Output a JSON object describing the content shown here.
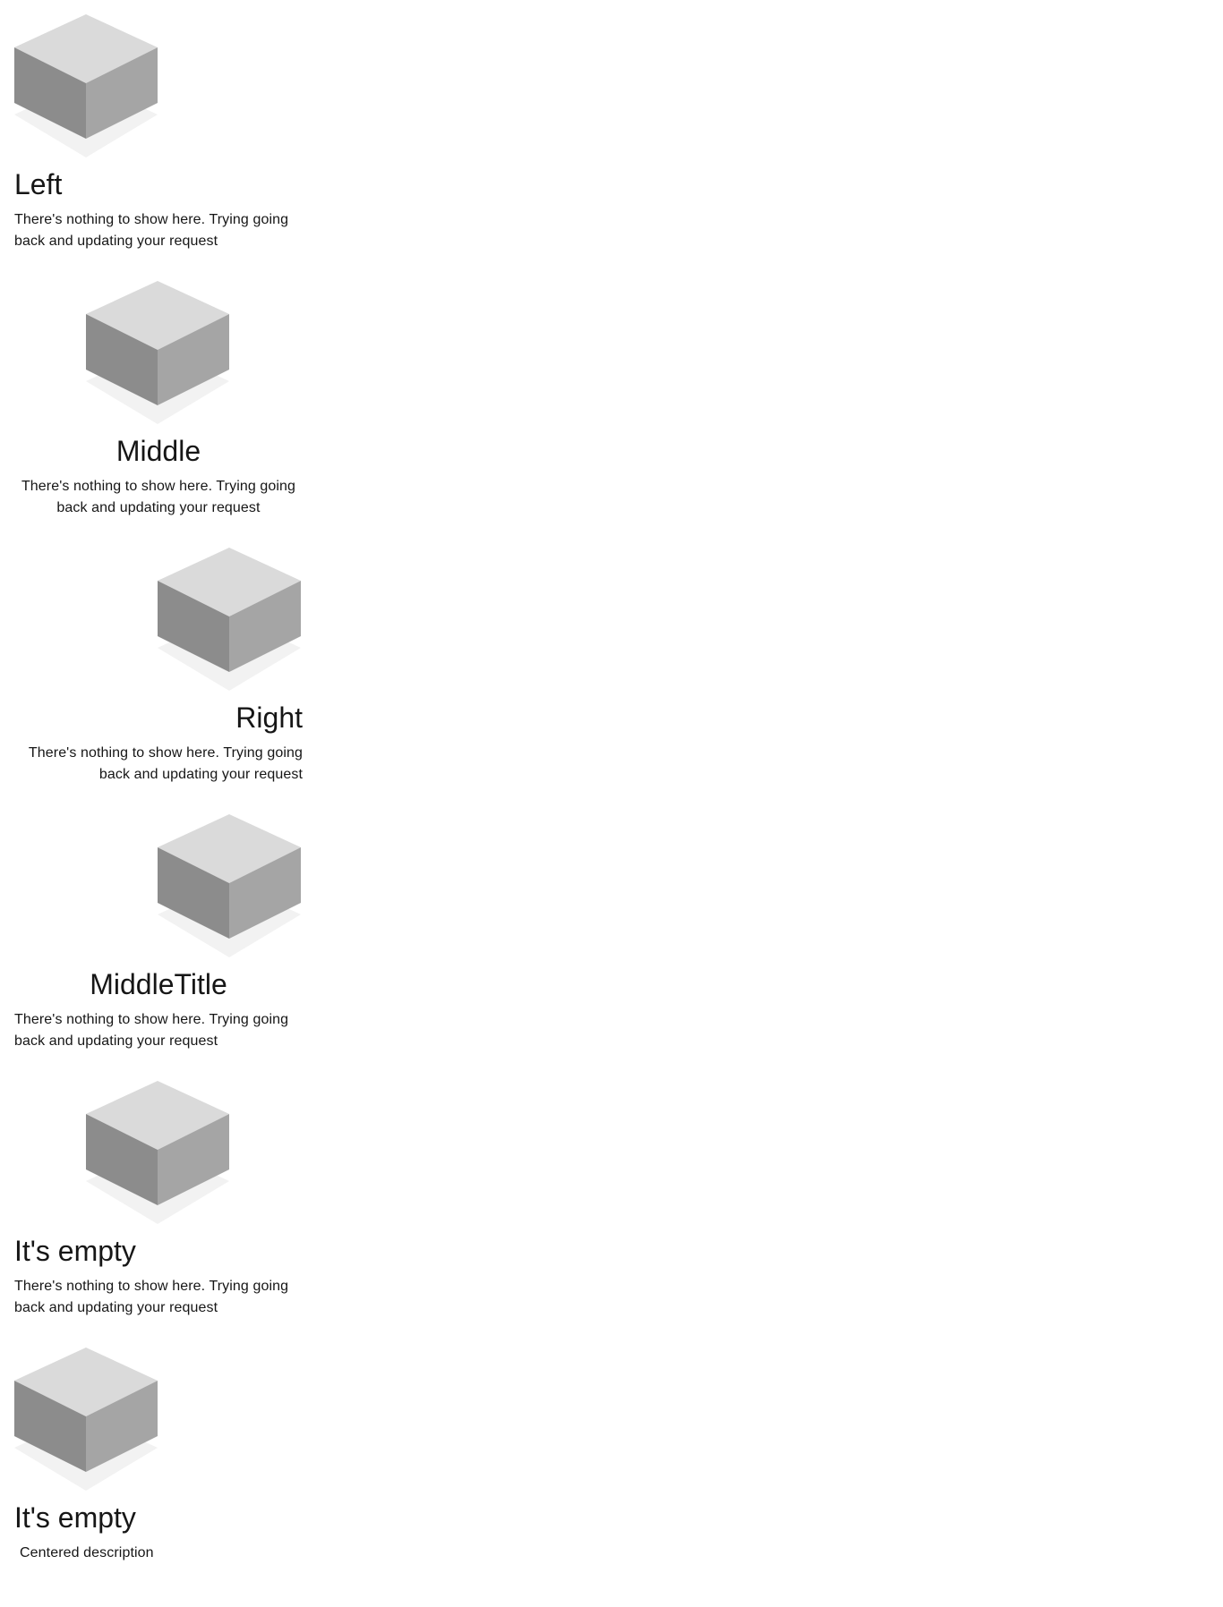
{
  "colors": {
    "background": "#ffffff",
    "text": "#161616",
    "cube_top": "#dadada",
    "cube_left": "#8c8c8c",
    "cube_right": "#a5a5a5",
    "cube_shadow": "#f2f2f2"
  },
  "illustration_icon": "empty-box-icon",
  "empty_states": [
    {
      "alignment": "left",
      "title": "Left",
      "description": "There's nothing to show here. Trying going back and updating your request"
    },
    {
      "alignment": "middle",
      "title": "Middle",
      "description": "There's nothing to show here. Trying going back and updating your request"
    },
    {
      "alignment": "right",
      "title": "Right",
      "description": "There's nothing to show here. Trying going back and updating your request"
    },
    {
      "alignment": "right-illustration, middle-title, left-description",
      "title": "MiddleTitle",
      "description": "There's nothing to show here. Trying going back and updating your request"
    },
    {
      "alignment": "middle-illustration, left-text",
      "title": "It's empty",
      "description": "There's nothing to show here. Trying going back and updating your request"
    },
    {
      "alignment": "left",
      "title": "It's empty",
      "description": "Centered description"
    }
  ]
}
